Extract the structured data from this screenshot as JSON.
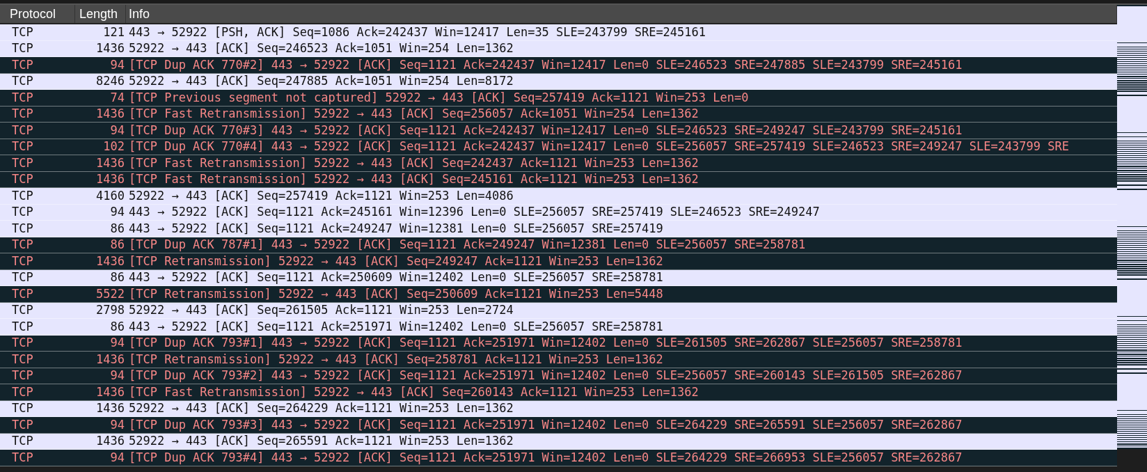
{
  "columns": [
    "Protocol",
    "Length",
    "Info"
  ],
  "rows": [
    {
      "kind": "normal",
      "protocol": "TCP",
      "length": "121",
      "info": "443 → 52922 [PSH, ACK] Seq=1086 Ack=242437 Win=12417 Len=35 SLE=243799 SRE=245161"
    },
    {
      "kind": "normal",
      "protocol": "TCP",
      "length": "1436",
      "info": "52922 → 443 [ACK] Seq=246523 Ack=1051 Win=254 Len=1362"
    },
    {
      "kind": "error",
      "protocol": "TCP",
      "length": "94",
      "info": "[TCP Dup ACK 770#2] 443 → 52922 [ACK] Seq=1121 Ack=242437 Win=12417 Len=0 SLE=246523 SRE=247885 SLE=243799 SRE=245161"
    },
    {
      "kind": "normal",
      "protocol": "TCP",
      "length": "8246",
      "info": "52922 → 443 [ACK] Seq=247885 Ack=1051 Win=254 Len=8172"
    },
    {
      "kind": "error",
      "protocol": "TCP",
      "length": "74",
      "info": "[TCP Previous segment not captured] 52922 → 443 [ACK] Seq=257419 Ack=1121 Win=253 Len=0"
    },
    {
      "kind": "error",
      "protocol": "TCP",
      "length": "1436",
      "info": "[TCP Fast Retransmission] 52922 → 443 [ACK] Seq=256057 Ack=1051 Win=254 Len=1362"
    },
    {
      "kind": "error",
      "protocol": "TCP",
      "length": "94",
      "info": "[TCP Dup ACK 770#3] 443 → 52922 [ACK] Seq=1121 Ack=242437 Win=12417 Len=0 SLE=246523 SRE=249247 SLE=243799 SRE=245161"
    },
    {
      "kind": "error",
      "protocol": "TCP",
      "length": "102",
      "info": "[TCP Dup ACK 770#4] 443 → 52922 [ACK] Seq=1121 Ack=242437 Win=12417 Len=0 SLE=256057 SRE=257419 SLE=246523 SRE=249247 SLE=243799 SRE"
    },
    {
      "kind": "error",
      "protocol": "TCP",
      "length": "1436",
      "info": "[TCP Fast Retransmission] 52922 → 443 [ACK] Seq=242437 Ack=1121 Win=253 Len=1362"
    },
    {
      "kind": "error",
      "protocol": "TCP",
      "length": "1436",
      "info": "[TCP Fast Retransmission] 52922 → 443 [ACK] Seq=245161 Ack=1121 Win=253 Len=1362"
    },
    {
      "kind": "normal",
      "protocol": "TCP",
      "length": "4160",
      "info": "52922 → 443 [ACK] Seq=257419 Ack=1121 Win=253 Len=4086"
    },
    {
      "kind": "normal",
      "protocol": "TCP",
      "length": "94",
      "info": "443 → 52922 [ACK] Seq=1121 Ack=245161 Win=12396 Len=0 SLE=256057 SRE=257419 SLE=246523 SRE=249247"
    },
    {
      "kind": "normal",
      "protocol": "TCP",
      "length": "86",
      "info": "443 → 52922 [ACK] Seq=1121 Ack=249247 Win=12381 Len=0 SLE=256057 SRE=257419"
    },
    {
      "kind": "error",
      "protocol": "TCP",
      "length": "86",
      "info": "[TCP Dup ACK 787#1] 443 → 52922 [ACK] Seq=1121 Ack=249247 Win=12381 Len=0 SLE=256057 SRE=258781"
    },
    {
      "kind": "error",
      "protocol": "TCP",
      "length": "1436",
      "info": "[TCP Retransmission] 52922 → 443 [ACK] Seq=249247 Ack=1121 Win=253 Len=1362"
    },
    {
      "kind": "normal",
      "protocol": "TCP",
      "length": "86",
      "info": "443 → 52922 [ACK] Seq=1121 Ack=250609 Win=12402 Len=0 SLE=256057 SRE=258781"
    },
    {
      "kind": "error",
      "protocol": "TCP",
      "length": "5522",
      "info": "[TCP Retransmission] 52922 → 443 [ACK] Seq=250609 Ack=1121 Win=253 Len=5448"
    },
    {
      "kind": "normal",
      "protocol": "TCP",
      "length": "2798",
      "info": "52922 → 443 [ACK] Seq=261505 Ack=1121 Win=253 Len=2724"
    },
    {
      "kind": "normal",
      "protocol": "TCP",
      "length": "86",
      "info": "443 → 52922 [ACK] Seq=1121 Ack=251971 Win=12402 Len=0 SLE=256057 SRE=258781"
    },
    {
      "kind": "error",
      "protocol": "TCP",
      "length": "94",
      "info": "[TCP Dup ACK 793#1] 443 → 52922 [ACK] Seq=1121 Ack=251971 Win=12402 Len=0 SLE=261505 SRE=262867 SLE=256057 SRE=258781"
    },
    {
      "kind": "error",
      "protocol": "TCP",
      "length": "1436",
      "info": "[TCP Retransmission] 52922 → 443 [ACK] Seq=258781 Ack=1121 Win=253 Len=1362"
    },
    {
      "kind": "error",
      "protocol": "TCP",
      "length": "94",
      "info": "[TCP Dup ACK 793#2] 443 → 52922 [ACK] Seq=1121 Ack=251971 Win=12402 Len=0 SLE=256057 SRE=260143 SLE=261505 SRE=262867"
    },
    {
      "kind": "error",
      "protocol": "TCP",
      "length": "1436",
      "info": "[TCP Fast Retransmission] 52922 → 443 [ACK] Seq=260143 Ack=1121 Win=253 Len=1362"
    },
    {
      "kind": "normal",
      "protocol": "TCP",
      "length": "1436",
      "info": "52922 → 443 [ACK] Seq=264229 Ack=1121 Win=253 Len=1362"
    },
    {
      "kind": "error",
      "protocol": "TCP",
      "length": "94",
      "info": "[TCP Dup ACK 793#3] 443 → 52922 [ACK] Seq=1121 Ack=251971 Win=12402 Len=0 SLE=264229 SRE=265591 SLE=256057 SRE=262867"
    },
    {
      "kind": "normal",
      "protocol": "TCP",
      "length": "1436",
      "info": "52922 → 443 [ACK] Seq=265591 Ack=1121 Win=253 Len=1362"
    },
    {
      "kind": "error",
      "protocol": "TCP",
      "length": "94",
      "info": "[TCP Dup ACK 793#4] 443 → 52922 [ACK] Seq=1121 Ack=251971 Win=12402 Len=0 SLE=264229 SRE=266953 SLE=256057 SRE=262867"
    }
  ]
}
